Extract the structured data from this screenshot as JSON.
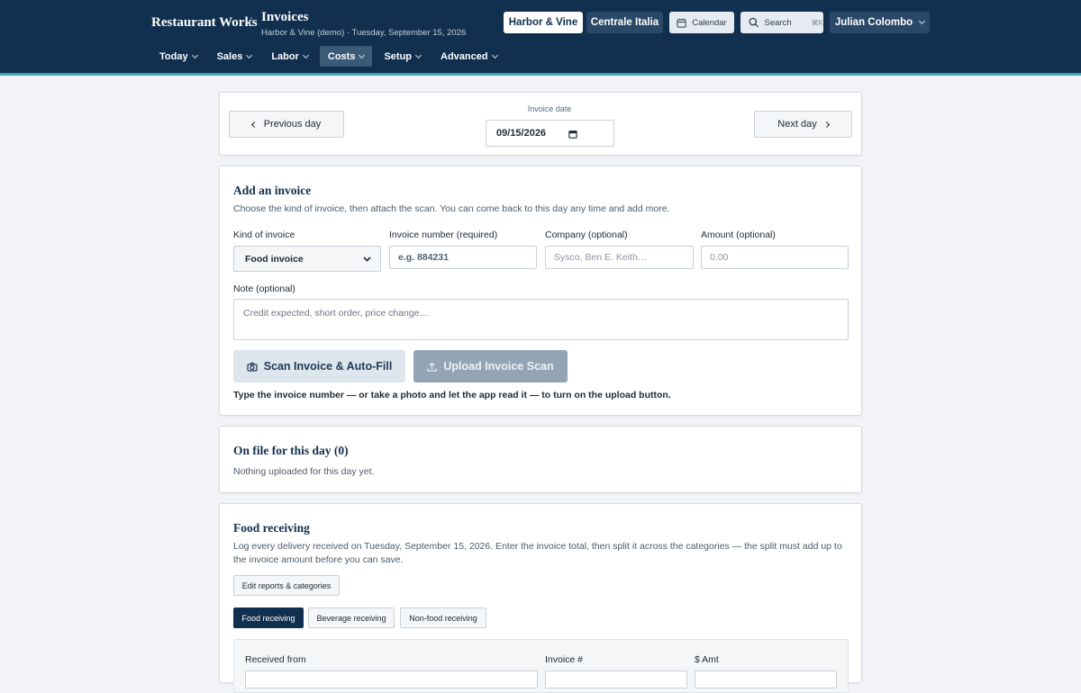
{
  "header": {
    "brand": "Restaurant Works",
    "separator": "/",
    "title": "Invoices",
    "subtitle": "Harbor & Vine (demo) · Tuesday, September 15, 2026",
    "location_primary": "Harbor & Vine",
    "location_secondary": "Centrale Italia",
    "calendar_label": "Calendar",
    "search_label": "Search",
    "search_shortcut": "⌘K",
    "user_name": "Julian Colombo",
    "accent_color": "#3fa6b9",
    "bar_color": "#11304f"
  },
  "nav": {
    "items": [
      {
        "label": "Today"
      },
      {
        "label": "Sales"
      },
      {
        "label": "Labor"
      },
      {
        "label": "Costs",
        "active": true
      },
      {
        "label": "Setup"
      },
      {
        "label": "Advanced"
      }
    ]
  },
  "date_nav": {
    "prev_label": "Previous day",
    "next_label": "Next day",
    "date_label": "Invoice date",
    "date_value": "09/15/2026"
  },
  "add_invoice": {
    "title": "Add an invoice",
    "description": "Choose the kind of invoice, then attach the scan. You can come back to this day any time and add more.",
    "kind_label": "Kind of invoice",
    "kind_value": "Food invoice",
    "number_label": "Invoice number (required)",
    "number_placeholder": "e.g. 884231",
    "company_label": "Company (optional)",
    "company_placeholder": "Sysco, Ben E. Keith…",
    "amount_label": "Amount (optional)",
    "amount_placeholder": "0.00",
    "note_label": "Note (optional)",
    "note_placeholder": "Credit expected, short order, price change…",
    "scan_button": "Scan Invoice & Auto-Fill",
    "upload_button": "Upload Invoice Scan",
    "hint": "Type the invoice number — or take a photo and let the app read it — to turn on the upload button."
  },
  "on_file": {
    "title": "On file for this day (0)",
    "empty_text": "Nothing uploaded for this day yet."
  },
  "food_receiving": {
    "title": "Food receiving",
    "description_line1": "Log every delivery received on Tuesday, September 15, 2026. Enter the invoice total, then split it across the categories — the split must add up to",
    "description_line2": "the invoice amount before you can save.",
    "edit_button": "Edit reports & categories",
    "tabs": [
      {
        "label": "Food receiving",
        "active": true
      },
      {
        "label": "Beverage receiving"
      },
      {
        "label": "Non-food receiving"
      }
    ],
    "columns": [
      "Received from",
      "Invoice #",
      "$ Amt"
    ]
  }
}
